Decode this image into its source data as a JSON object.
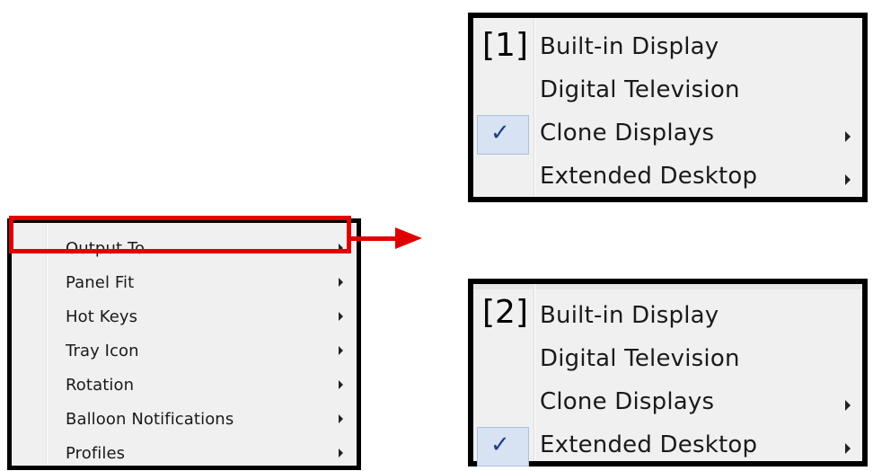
{
  "left_menu": {
    "items": [
      {
        "label": "Output To",
        "has_submenu": true,
        "highlighted": true
      },
      {
        "label": "Panel Fit",
        "has_submenu": true
      },
      {
        "label": "Hot Keys",
        "has_submenu": true
      },
      {
        "label": "Tray Icon",
        "has_submenu": true
      },
      {
        "label": "Rotation",
        "has_submenu": true
      },
      {
        "label": "Balloon Notifications",
        "has_submenu": true
      },
      {
        "label": "Profiles",
        "has_submenu": true
      }
    ],
    "highlight_color": "#e10000"
  },
  "submenu_1": {
    "index_label": "[1]",
    "items": [
      {
        "label": "Built-in Display",
        "checked": false,
        "has_submenu": false
      },
      {
        "label": "Digital Television",
        "checked": false,
        "has_submenu": false
      },
      {
        "label": "Clone Displays",
        "checked": true,
        "has_submenu": true
      },
      {
        "label": "Extended Desktop",
        "checked": false,
        "has_submenu": true
      }
    ]
  },
  "submenu_2": {
    "index_label": "[2]",
    "items": [
      {
        "label": "Built-in Display",
        "checked": false,
        "has_submenu": false
      },
      {
        "label": "Digital Television",
        "checked": false,
        "has_submenu": false
      },
      {
        "label": "Clone Displays",
        "checked": false,
        "has_submenu": true
      },
      {
        "label": "Extended Desktop",
        "checked": true,
        "has_submenu": true
      }
    ]
  },
  "check_glyph": "✓",
  "colors": {
    "menu_bg": "#f0f0f0",
    "check_bg": "#d7e3f2",
    "check_color": "#1e3f82",
    "arrow_red": "#e10000"
  }
}
